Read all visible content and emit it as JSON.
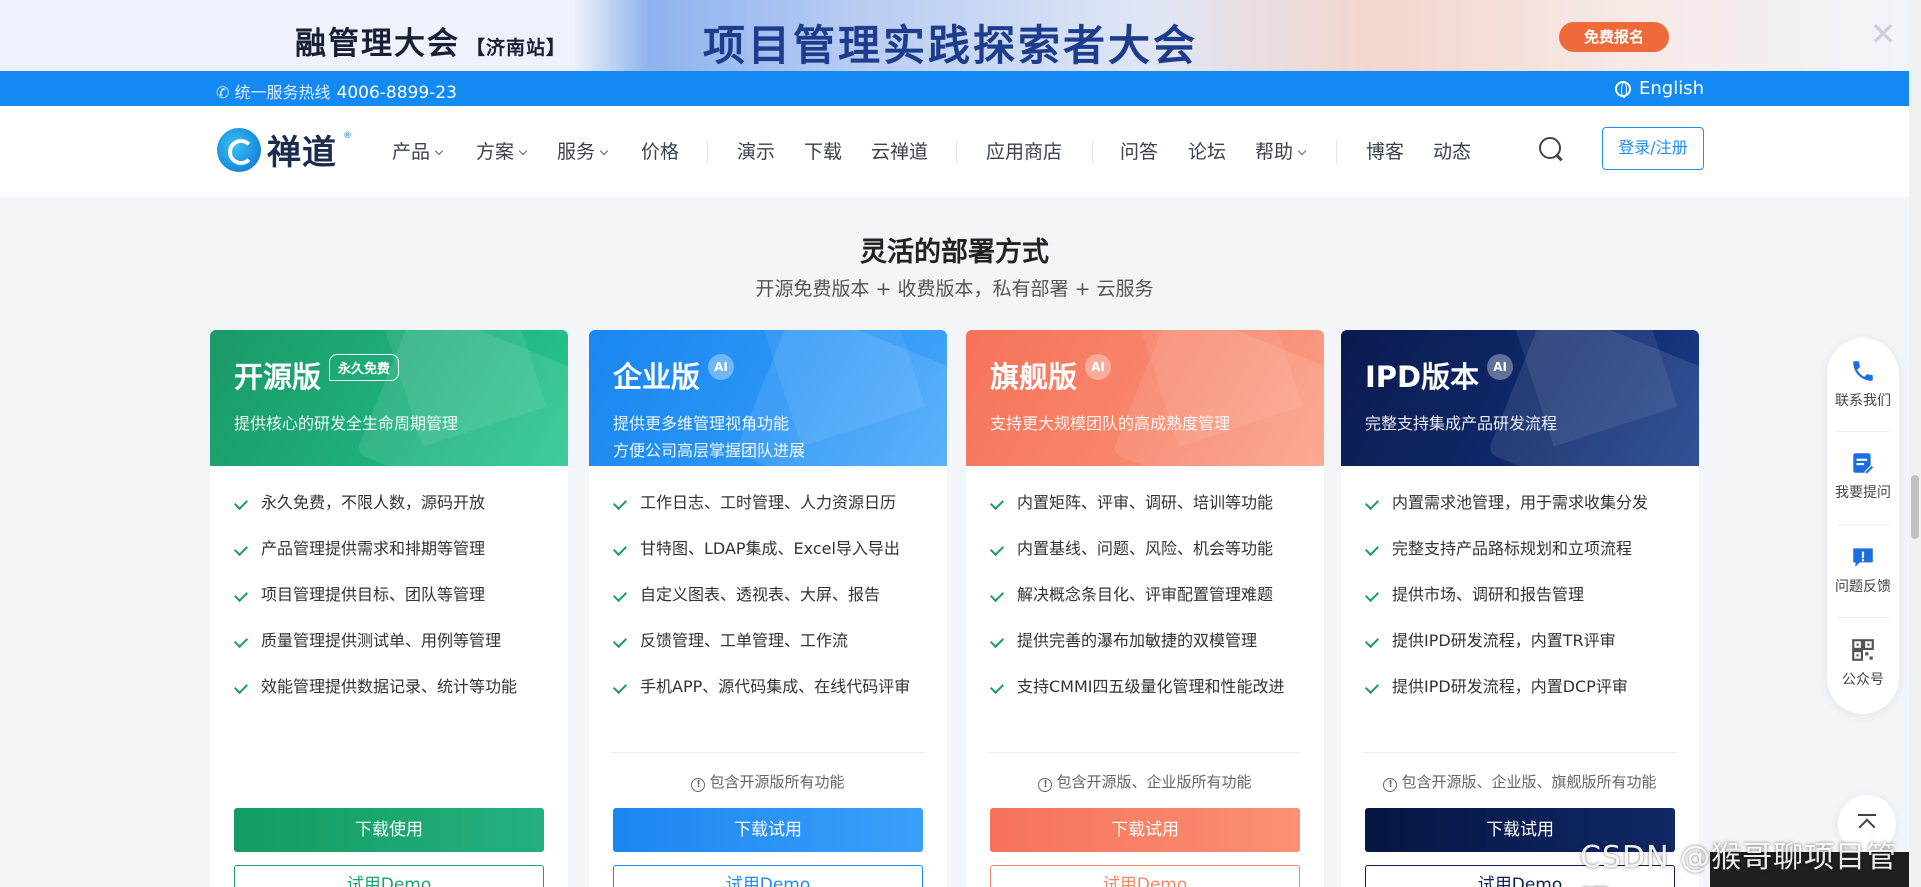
{
  "promo": {
    "left_title": "融管理大会",
    "left_station": "【济南站】",
    "main_title": "项目管理实践探索者大会",
    "cta": "免费报名",
    "close": "✕"
  },
  "hotline": {
    "label": "统一服务热线",
    "number": "4006-8899-23",
    "language": "English"
  },
  "nav": {
    "logo_text": "禅道",
    "items": [
      "产品",
      "方案",
      "服务",
      "价格",
      "演示",
      "下载",
      "云禅道",
      "应用商店",
      "问答",
      "论坛",
      "帮助",
      "博客",
      "动态"
    ],
    "login": "登录/注册"
  },
  "section": {
    "title": "灵活的部署方式",
    "subtitle": "开源免费版本 + 收费版本，私有部署 + 云服务"
  },
  "cards": [
    {
      "name": "开源版",
      "tag": "永久免费",
      "desc1": "提供核心的研发全生命周期管理",
      "desc2": "",
      "features": [
        "永久免费，不限人数，源码开放",
        "产品管理提供需求和排期等管理",
        "项目管理提供目标、团队等管理",
        "质量管理提供测试单、用例等管理",
        "效能管理提供数据记录、统计等功能"
      ],
      "includes": "",
      "primary": "下载使用",
      "secondary": "试用Demo",
      "color": "#1e9f6b"
    },
    {
      "name": "企业版",
      "ai": "AI",
      "desc1": "提供更多维管理视角功能",
      "desc2": "方便公司高层掌握团队进展",
      "features": [
        "工作日志、工时管理、人力资源日历",
        "甘特图、LDAP集成、Excel导入导出",
        "自定义图表、透视表、大屏、报告",
        "反馈管理、工单管理、工作流",
        "手机APP、源代码集成、在线代码评审"
      ],
      "includes": "包含开源版所有功能",
      "primary": "下载试用",
      "secondary": "试用Demo",
      "color": "#1d8cf2"
    },
    {
      "name": "旗舰版",
      "ai": "AI",
      "desc1": "支持更大规模团队的高成熟度管理",
      "desc2": "",
      "features": [
        "内置矩阵、评审、调研、培训等功能",
        "内置基线、问题、风险、机会等功能",
        "解决概念条目化、评审配置管理难题",
        "提供完善的瀑布加敏捷的双模管理",
        "支持CMMI四五级量化管理和性能改进"
      ],
      "includes": "包含开源版、企业版所有功能",
      "primary": "下载试用",
      "secondary": "试用Demo",
      "color": "#f7856a"
    },
    {
      "name": "IPD版本",
      "ai": "AI",
      "desc1": "完整支持集成产品研发流程",
      "desc2": "",
      "features": [
        "内置需求池管理，用于需求收集分发",
        "完整支持产品路标规划和立项流程",
        "提供市场、调研和报告管理",
        "提供IPD研发流程，内置TR评审",
        "提供IPD研发流程，内置DCP评审"
      ],
      "includes": "包含开源版、企业版、旗舰版所有功能",
      "primary": "下载试用",
      "secondary": "试用Demo",
      "color": "#0c1f55"
    }
  ],
  "float_bar": {
    "items": [
      "联系我们",
      "我要提问",
      "问题反馈",
      "公众号"
    ]
  },
  "watermark": "CSDN @猴哥聊项目管理"
}
